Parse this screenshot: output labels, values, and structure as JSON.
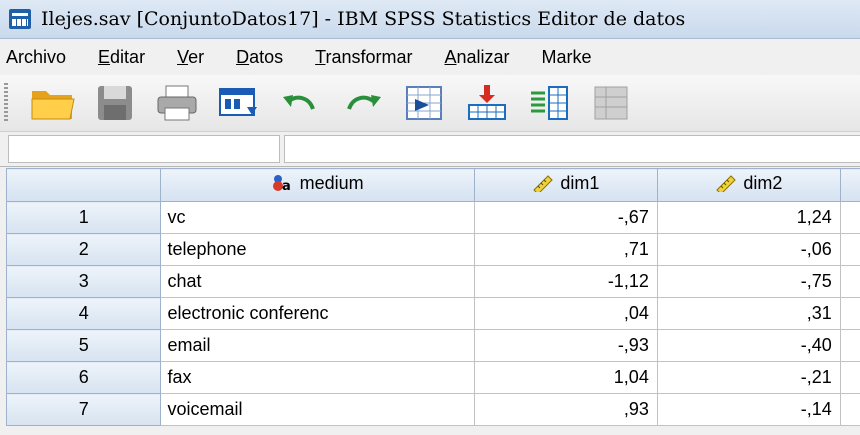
{
  "window": {
    "title": "Ilejes.sav [ConjuntoDatos17] - IBM SPSS Statistics Editor de datos"
  },
  "menubar": {
    "items": [
      {
        "underline": "",
        "rest": "Archivo"
      },
      {
        "underline": "E",
        "rest": "ditar"
      },
      {
        "underline": "V",
        "rest": "er"
      },
      {
        "underline": "D",
        "rest": "atos"
      },
      {
        "underline": "T",
        "rest": "ransformar"
      },
      {
        "underline": "A",
        "rest": "nalizar"
      },
      {
        "underline": "",
        "rest": "Marke"
      }
    ]
  },
  "toolbar": {
    "buttons": [
      "open-folder-icon",
      "save-icon",
      "print-icon",
      "dialog-recall-icon",
      "undo-icon",
      "redo-icon",
      "goto-case-icon",
      "goto-variable-icon",
      "variables-icon",
      "value-labels-icon"
    ]
  },
  "grid": {
    "columns": [
      {
        "name": "medium",
        "icon": "string-variable-icon"
      },
      {
        "name": "dim1",
        "icon": "scale-ruler-icon"
      },
      {
        "name": "dim2",
        "icon": "scale-ruler-icon"
      }
    ],
    "rows": [
      {
        "num": "1",
        "medium": "vc",
        "dim1": "-,67",
        "dim2": "1,24"
      },
      {
        "num": "2",
        "medium": "telephone",
        "dim1": ",71",
        "dim2": "-,06"
      },
      {
        "num": "3",
        "medium": "chat",
        "dim1": "-1,12",
        "dim2": "-,75"
      },
      {
        "num": "4",
        "medium": "electronic conferenc",
        "dim1": ",04",
        "dim2": ",31"
      },
      {
        "num": "5",
        "medium": "email",
        "dim1": "-,93",
        "dim2": "-,40"
      },
      {
        "num": "6",
        "medium": "fax",
        "dim1": "1,04",
        "dim2": "-,21"
      },
      {
        "num": "7",
        "medium": "voicemail",
        "dim1": ",93",
        "dim2": "-,14"
      }
    ]
  }
}
